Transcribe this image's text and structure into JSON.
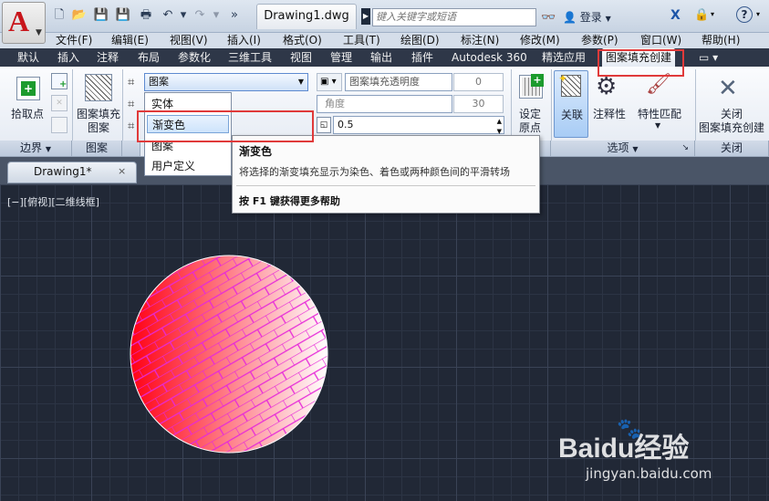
{
  "app": {
    "logo_letter": "A",
    "document_title": "Drawing1.dwg",
    "search_placeholder": "键入关键字或短语",
    "login_label": "登录",
    "help_label": "?"
  },
  "menu": [
    "文件(F)",
    "编辑(E)",
    "视图(V)",
    "插入(I)",
    "格式(O)",
    "工具(T)",
    "绘图(D)",
    "标注(N)",
    "修改(M)",
    "参数(P)",
    "窗口(W)",
    "帮助(H)"
  ],
  "ribbon_tabs": [
    "默认",
    "插入",
    "注释",
    "布局",
    "参数化",
    "三维工具",
    "视图",
    "管理",
    "输出",
    "插件",
    "Autodesk 360",
    "精选应用",
    "图案填充创建"
  ],
  "ribbon": {
    "pick_points_label": "拾取点",
    "hatch_pattern_label_1": "图案填充",
    "hatch_pattern_label_2": "图案",
    "pattern_type_value": "图案",
    "transparency_label": "图案填充透明度",
    "transparency_value": "0",
    "angle_label": "角度",
    "angle_value": "30",
    "scale_value": "0.5",
    "set_origin_label_1": "设定",
    "set_origin_label_2": "原点",
    "associative_label": "关联",
    "annotative_label": "注释性",
    "match_properties_label": "特性匹配",
    "close_label_1": "关闭",
    "close_label_2": "图案填充创建",
    "panel_boundary": "边界",
    "panel_pattern": "图案",
    "panel_options": "选项",
    "panel_close": "关闭"
  },
  "dropdown_options": [
    "实体",
    "渐变色",
    "图案",
    "用户定义"
  ],
  "tooltip": {
    "title": "渐变色",
    "description": "将选择的渐变填充显示为染色、着色或两种颜色间的平滑转场",
    "help": "按 F1 键获得更多帮助"
  },
  "drawing_tab": {
    "label": "Drawing1*",
    "close": "×"
  },
  "viewport_label": "[−][俯视][二维线框]",
  "watermark": {
    "brand": "Baidu经验",
    "url": "jingyan.baidu.com"
  },
  "colors": {
    "hatch_gradient_start": "#ff0014",
    "hatch_gradient_end": "#ffffff",
    "brick_lines": "#e62ad8",
    "highlight_red": "#e03a3a"
  }
}
